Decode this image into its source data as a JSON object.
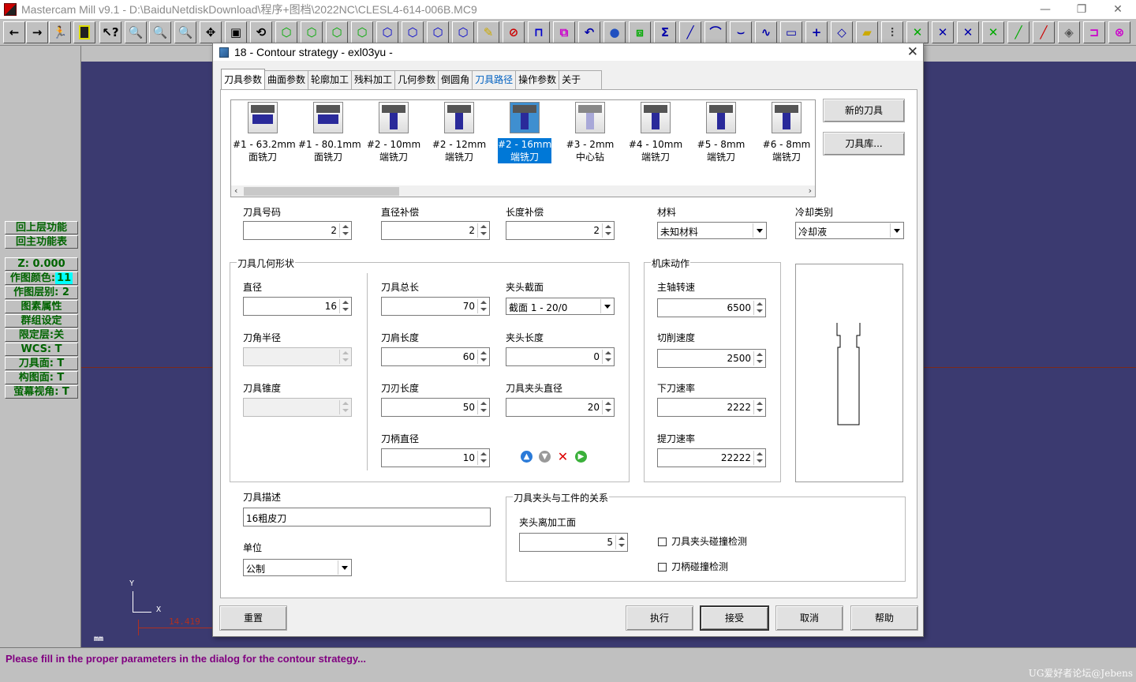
{
  "app": {
    "title": "Mastercam Mill v9.1 - D:\\BaiduNetdiskDownload\\程序+图档\\2022NC\\CLESL4-614-006B.MC9",
    "controls": {
      "minimize": "—",
      "maximize": "❐",
      "close": "✕"
    }
  },
  "left_panel": {
    "items": [
      {
        "label": "回上层功能"
      },
      {
        "label": "回主功能表"
      },
      {
        "label": "Z:  0.000"
      },
      {
        "label": "作图颜色:",
        "value": "11"
      },
      {
        "label": "作图层别:  2"
      },
      {
        "label": "图素属性"
      },
      {
        "label": "群组设定"
      },
      {
        "label": "限定层:关"
      },
      {
        "label": "WCS:  T"
      },
      {
        "label": "刀具面:  T"
      },
      {
        "label": "构图面:  T"
      },
      {
        "label": "萤幕视角:  T"
      }
    ]
  },
  "viewport": {
    "axis_y": "Y",
    "axis_x": "X",
    "coord_readout": "14.419",
    "unit": "mm"
  },
  "status": {
    "message": "Please fill in the proper parameters in the dialog for the contour strategy...",
    "watermark": "UG爱好者论坛@Jebens"
  },
  "dialog": {
    "title": "18 - Contour strategy - exl03yu -",
    "tabs": [
      "刀具参数",
      "曲面参数",
      "轮廓加工",
      "残料加工",
      "几何参数",
      "倒圆角",
      "刀具路径",
      "操作参数",
      "关于"
    ],
    "active_tab": "刀具参数",
    "tools": [
      {
        "num": "#1 - 63.2mm",
        "type": "面铣刀"
      },
      {
        "num": "#1 - 80.1mm",
        "type": "面铣刀"
      },
      {
        "num": "#2 - 10mm",
        "type": "端铣刀"
      },
      {
        "num": "#2 - 12mm",
        "type": "端铣刀"
      },
      {
        "num": "#2 - 16mm",
        "type": "端铣刀"
      },
      {
        "num": "#3 - 2mm",
        "type": "中心钻"
      },
      {
        "num": "#4 - 10mm",
        "type": "端铣刀"
      },
      {
        "num": "#5 - 8mm",
        "type": "端铣刀"
      },
      {
        "num": "#6 - 8mm",
        "type": "端铣刀"
      }
    ],
    "selected_tool": "#2 - 16mm",
    "buttons": {
      "new_tool": "新的刀具",
      "tool_library": "刀具库...",
      "reset": "重置",
      "execute": "执行",
      "accept": "接受",
      "cancel": "取消",
      "help": "帮助"
    },
    "fields": {
      "tool_number": {
        "label": "刀具号码",
        "value": "2"
      },
      "dia_offset": {
        "label": "直径补偿",
        "value": "2"
      },
      "len_offset": {
        "label": "长度补偿",
        "value": "2"
      },
      "material": {
        "label": "材料",
        "value": "未知材料"
      },
      "coolant": {
        "label": "冷却类别",
        "value": "冷却液"
      }
    },
    "geometry": {
      "group_title": "刀具几何形状",
      "diameter": {
        "label": "直径",
        "value": "16"
      },
      "corner_radius": {
        "label": "刀角半径",
        "value": ""
      },
      "taper": {
        "label": "刀具锥度",
        "value": ""
      },
      "overall_length": {
        "label": "刀具总长",
        "value": "70"
      },
      "shoulder_length": {
        "label": "刀肩长度",
        "value": "60"
      },
      "flute_length": {
        "label": "刀刃长度",
        "value": "50"
      },
      "shank_diameter": {
        "label": "刀柄直径",
        "value": "10"
      },
      "holder_section": {
        "label": "夹头截面",
        "value": "截面 1 - 20/0"
      },
      "holder_length": {
        "label": "夹头长度",
        "value": "0"
      },
      "holder_diameter": {
        "label": "刀具夹头直径",
        "value": "20"
      }
    },
    "machine": {
      "group_title": "机床动作",
      "spindle": {
        "label": "主轴转速",
        "value": "6500"
      },
      "feed": {
        "label": "切削速度",
        "value": "2500"
      },
      "plunge": {
        "label": "下刀速率",
        "value": "2222"
      },
      "retract": {
        "label": "提刀速率",
        "value": "22222"
      }
    },
    "description": {
      "label": "刀具描述",
      "value": "16粗皮刀"
    },
    "units": {
      "label": "单位",
      "value": "公制"
    },
    "holder_rel": {
      "group_title": "刀具夹头与工件的关系",
      "clearance": {
        "label": "夹头离加工面",
        "value": "5"
      },
      "check_holder": "刀具夹头碰撞检测",
      "check_shank": "刀柄碰撞检测"
    }
  }
}
